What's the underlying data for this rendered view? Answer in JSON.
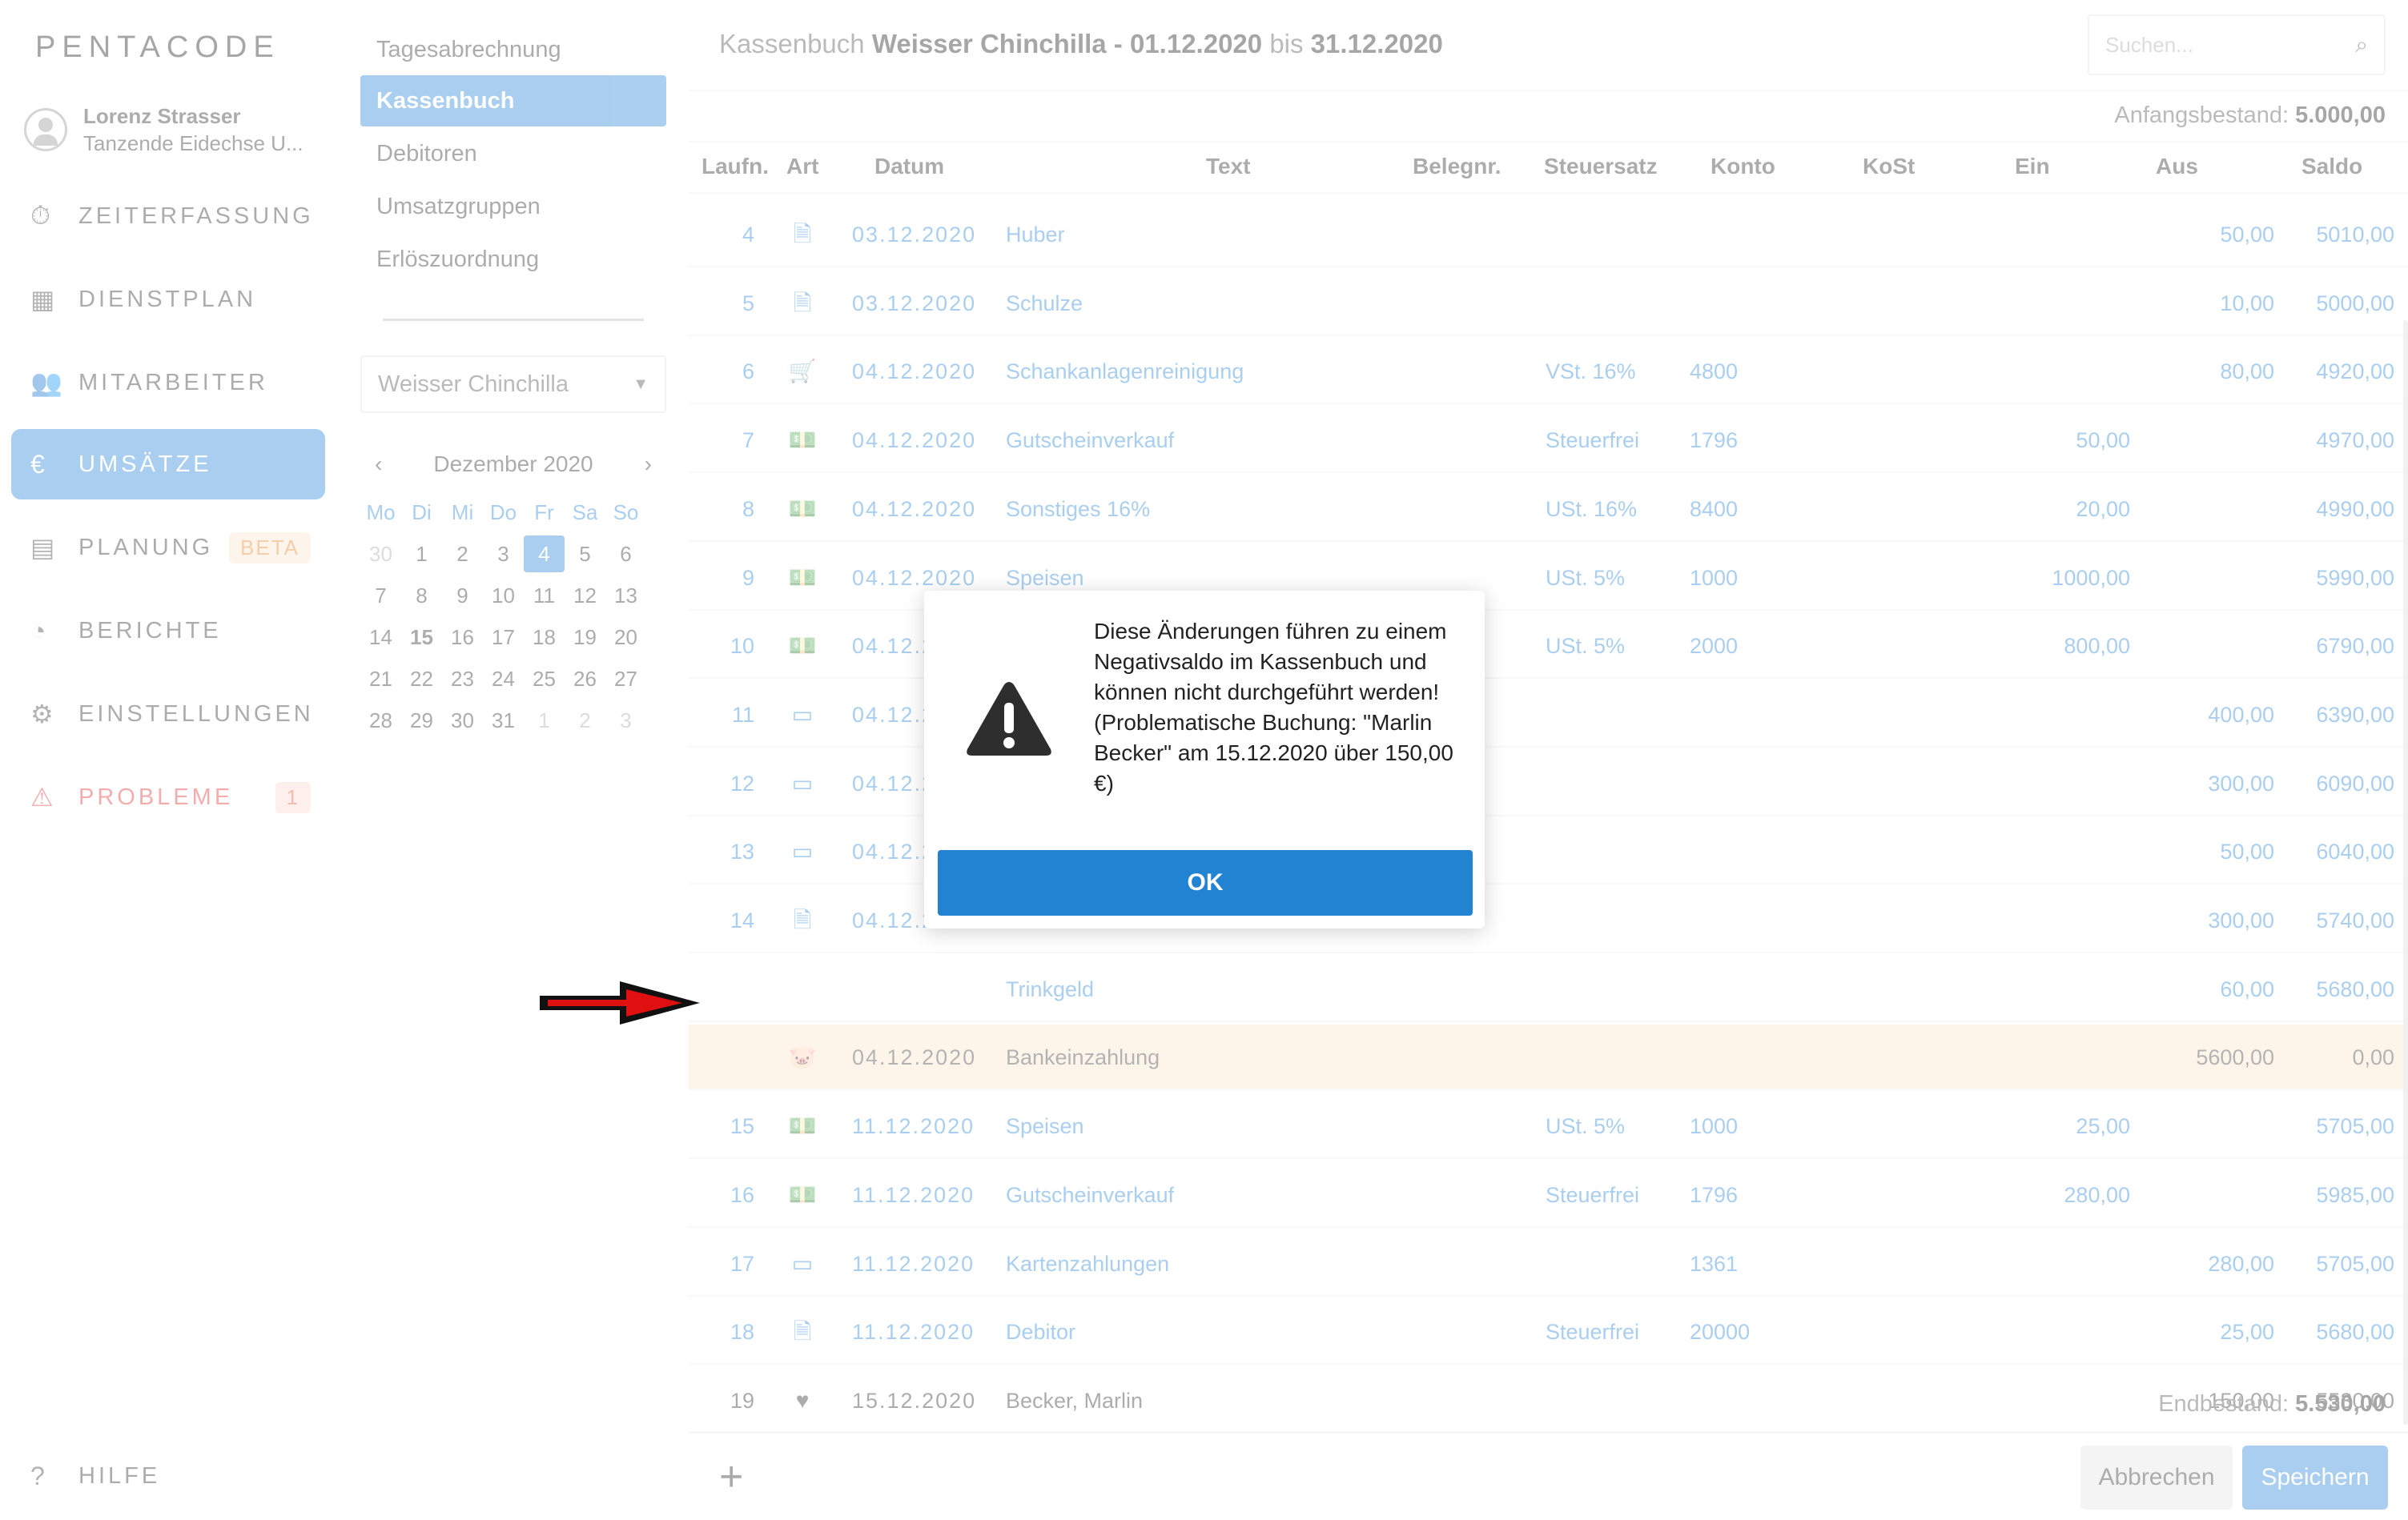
{
  "brand": {
    "logo": "PENTACODE"
  },
  "user": {
    "name": "Lorenz Strasser",
    "sub": "Tanzende Eidechse U..."
  },
  "nav": {
    "items": [
      {
        "icon": "stopwatch-icon",
        "label": "ZEITERFASSUNG"
      },
      {
        "icon": "table-icon",
        "label": "DIENSTPLAN"
      },
      {
        "icon": "users-icon",
        "label": "MITARBEITER"
      },
      {
        "icon": "euro-icon",
        "label": "UMSÄTZE"
      },
      {
        "icon": "calendar-icon",
        "label": "PLANUNG",
        "badge": "BETA"
      },
      {
        "icon": "pie-chart-icon",
        "label": "BERICHTE"
      },
      {
        "icon": "gear-icon",
        "label": "EINSTELLUNGEN"
      },
      {
        "icon": "warning-icon",
        "label": "PROBLEME",
        "badge": "1"
      }
    ],
    "help": "HILFE"
  },
  "subnav": {
    "items": [
      "Tagesabrechnung",
      "Kassenbuch",
      "Debitoren",
      "Umsatzgruppen",
      "Erlöszuordnung"
    ],
    "location": "Weisser Chinchilla"
  },
  "calendar": {
    "month": "Dezember 2020",
    "weekdays": [
      "Mo",
      "Di",
      "Mi",
      "Do",
      "Fr",
      "Sa",
      "So"
    ],
    "weeks": [
      [
        "30",
        "1",
        "2",
        "3",
        "4",
        "5",
        "6"
      ],
      [
        "7",
        "8",
        "9",
        "10",
        "11",
        "12",
        "13"
      ],
      [
        "14",
        "15",
        "16",
        "17",
        "18",
        "19",
        "20"
      ],
      [
        "21",
        "22",
        "23",
        "24",
        "25",
        "26",
        "27"
      ],
      [
        "28",
        "29",
        "30",
        "31",
        "1",
        "2",
        "3"
      ]
    ]
  },
  "header": {
    "prefix": "Kassenbuch",
    "location": "Weisser Chinchilla",
    "sep": " - ",
    "from": "01.12.2020",
    "bis": "bis",
    "to": "31.12.2020",
    "search_placeholder": "Suchen..."
  },
  "balances": {
    "start_label": "Anfangsbestand:",
    "start_value": "5.000,00",
    "end_label": "Endbestand:",
    "end_value": "5.530,00"
  },
  "table": {
    "headers": [
      "Laufn.",
      "Art",
      "Datum",
      "Text",
      "Belegnr.",
      "Steuersatz",
      "Konto",
      "KoSt",
      "Ein",
      "Aus",
      "Saldo"
    ],
    "rows": [
      {
        "nr": "4",
        "icon": "document-icon",
        "datum": "03.12.2020",
        "text": "Huber",
        "steuer": "",
        "konto": "",
        "ein": "",
        "aus": "50,00",
        "saldo": "5010,00"
      },
      {
        "nr": "5",
        "icon": "document-icon",
        "datum": "03.12.2020",
        "text": "Schulze",
        "steuer": "",
        "konto": "",
        "ein": "",
        "aus": "10,00",
        "saldo": "5000,00"
      },
      {
        "nr": "6",
        "icon": "cart-icon",
        "datum": "04.12.2020",
        "text": "Schankanlagenreinigung",
        "steuer": "VSt. 16%",
        "konto": "4800",
        "ein": "",
        "aus": "80,00",
        "saldo": "4920,00"
      },
      {
        "nr": "7",
        "icon": "cash-icon",
        "datum": "04.12.2020",
        "text": "Gutscheinverkauf",
        "steuer": "Steuerfrei",
        "konto": "1796",
        "ein": "50,00",
        "aus": "",
        "saldo": "4970,00"
      },
      {
        "nr": "8",
        "icon": "cash-icon",
        "datum": "04.12.2020",
        "text": "Sonstiges 16%",
        "steuer": "USt. 16%",
        "konto": "8400",
        "ein": "20,00",
        "aus": "",
        "saldo": "4990,00"
      },
      {
        "nr": "9",
        "icon": "cash-icon",
        "datum": "04.12.2020",
        "text": "Speisen",
        "steuer": "USt. 5%",
        "konto": "1000",
        "ein": "1000,00",
        "aus": "",
        "saldo": "5990,00"
      },
      {
        "nr": "10",
        "icon": "cash-icon",
        "datum": "04.12.2",
        "text": "",
        "steuer": "USt. 5%",
        "konto": "2000",
        "ein": "800,00",
        "aus": "",
        "saldo": "6790,00"
      },
      {
        "nr": "11",
        "icon": "credit-card-icon",
        "datum": "04.12.2",
        "text": "",
        "steuer": "",
        "konto": "",
        "ein": "",
        "aus": "400,00",
        "saldo": "6390,00"
      },
      {
        "nr": "12",
        "icon": "credit-card-icon",
        "datum": "04.12.2",
        "text": "",
        "steuer": "",
        "konto": "",
        "ein": "",
        "aus": "300,00",
        "saldo": "6090,00"
      },
      {
        "nr": "13",
        "icon": "credit-card-icon",
        "datum": "04.12.2",
        "text": "",
        "steuer": "",
        "konto": "",
        "ein": "",
        "aus": "50,00",
        "saldo": "6040,00"
      },
      {
        "nr": "14",
        "icon": "document-icon",
        "datum": "04.12.2",
        "text": "",
        "steuer": "",
        "konto": "",
        "ein": "",
        "aus": "300,00",
        "saldo": "5740,00"
      },
      {
        "nr": "",
        "icon": "",
        "datum": "",
        "text": "Trinkgeld",
        "steuer": "",
        "konto": "",
        "ein": "",
        "aus": "60,00",
        "saldo": "5680,00"
      },
      {
        "nr": "",
        "icon": "piggy-bank-icon",
        "datum": "04.12.2020",
        "text": "Bankeinzahlung",
        "steuer": "",
        "konto": "",
        "ein": "",
        "aus": "5600,00",
        "saldo": "0,00"
      },
      {
        "nr": "15",
        "icon": "cash-icon",
        "datum": "11.12.2020",
        "text": "Speisen",
        "steuer": "USt. 5%",
        "konto": "1000",
        "ein": "25,00",
        "aus": "",
        "saldo": "5705,00"
      },
      {
        "nr": "16",
        "icon": "cash-icon",
        "datum": "11.12.2020",
        "text": "Gutscheinverkauf",
        "steuer": "Steuerfrei",
        "konto": "1796",
        "ein": "280,00",
        "aus": "",
        "saldo": "5985,00"
      },
      {
        "nr": "17",
        "icon": "credit-card-icon",
        "datum": "11.12.2020",
        "text": "Kartenzahlungen",
        "steuer": "",
        "konto": "1361",
        "ein": "",
        "aus": "280,00",
        "saldo": "5705,00"
      },
      {
        "nr": "18",
        "icon": "document-icon",
        "datum": "11.12.2020",
        "text": "Debitor",
        "steuer": "Steuerfrei",
        "konto": "20000",
        "ein": "",
        "aus": "25,00",
        "saldo": "5680,00"
      },
      {
        "nr": "19",
        "icon": "heart-icon",
        "datum": "15.12.2020",
        "text": "Becker, Marlin",
        "steuer": "",
        "konto": "",
        "ein": "",
        "aus": "150,00",
        "saldo": "5530,00"
      }
    ]
  },
  "footer": {
    "add": "+",
    "cancel": "Abbrechen",
    "save": "Speichern"
  },
  "modal": {
    "message": "Diese Änderungen führen zu einem Negativsaldo im Kassenbuch und können nicht durchgeführt werden! (Problematische Buchung: \"Marlin Becker\" am 15.12.2020 über 150,00 €)",
    "ok": "OK"
  },
  "colors": {
    "accent": "#2a86d8",
    "highlight": "#fde8cc",
    "danger": "#e23535",
    "arrow": "#e01010"
  }
}
